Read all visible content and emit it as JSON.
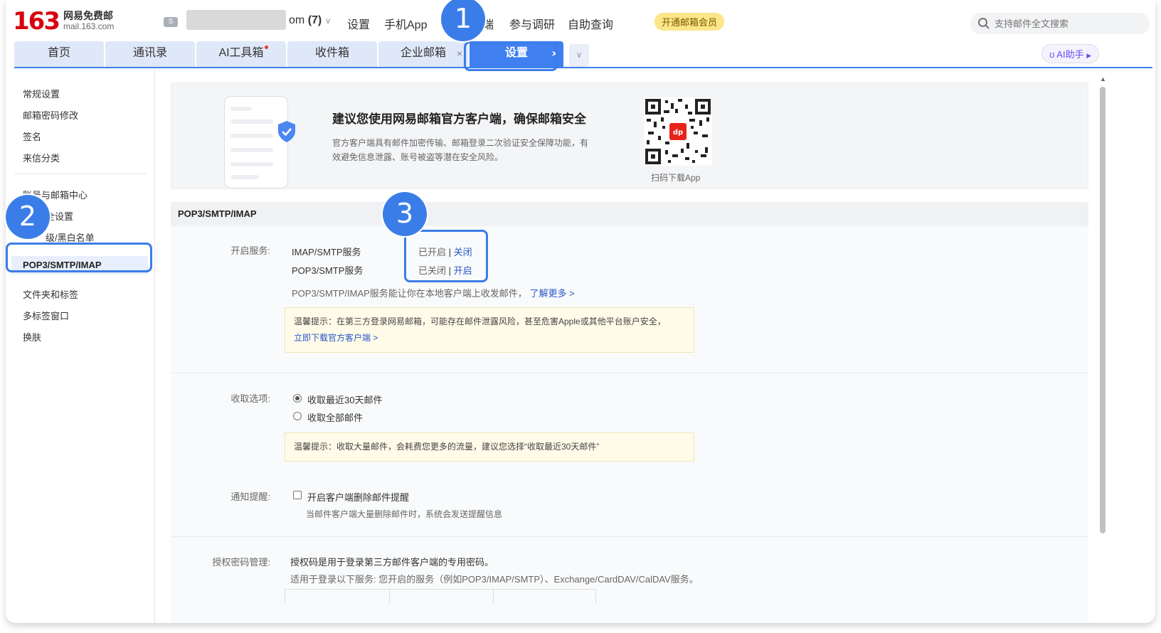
{
  "header": {
    "logo_number": "163",
    "logo_cn": "网易免费邮",
    "logo_url": "mail.163.com",
    "account_suffix": "om",
    "account_count": "(7)",
    "links": [
      "设置",
      "手机App",
      "端",
      "参与调研",
      "自助查询"
    ],
    "vip_label": "开通邮箱会员",
    "search_placeholder": "支持邮件全文搜索"
  },
  "tabs": {
    "items": [
      "首页",
      "通讯录",
      "AI工具箱",
      "收件箱",
      "企业邮箱",
      "设置"
    ],
    "close_symbol": "×",
    "more_symbol": "∨",
    "ai_button": "AI助手"
  },
  "sidebar": {
    "group1": [
      "常规设置",
      "邮箱密码修改",
      "签名",
      "来信分类"
    ],
    "group2": [
      "账号与邮箱中心",
      "全设置",
      "级/黑白名单"
    ],
    "active": "POP3/SMTP/IMAP",
    "group3": [
      "文件夹和标签",
      "多标签窗口",
      "换肤"
    ]
  },
  "banner": {
    "title": "建议您使用网易邮箱官方客户端，确保邮箱安全",
    "desc": "官方客户端具有邮件加密传输、邮箱登录二次验证安全保障功能，有效避免信息泄露、账号被盗等潜在安全风险。",
    "qr_label": "扫码下载App"
  },
  "section": {
    "title": "POP3/SMTP/IMAP",
    "service_label": "开启服务:",
    "services": [
      {
        "name": "IMAP/SMTP服务",
        "status": "已开启",
        "action": "关闭"
      },
      {
        "name": "POP3/SMTP服务",
        "status": "已关闭",
        "action": "开启"
      }
    ],
    "service_sep": "|",
    "service_desc": "POP3/SMTP/IMAP服务能让你在本地客户端上收发邮件，",
    "learn_more": "了解更多 >",
    "tip1": "温馨提示：在第三方登录网易邮箱，可能存在邮件泄露风险，甚至危害Apple或其他平台账户安全，",
    "tip1_link": "立即下载官方客户端 >",
    "fetch_label": "收取选项:",
    "fetch_opt1": "收取最近30天邮件",
    "fetch_opt2": "收取全部邮件",
    "tip2": "温馨提示：收取大量邮件，会耗费您更多的流量，建议您选择“收取最近30天邮件”",
    "notify_label": "通知提醒:",
    "notify_opt": "开启客户端删除邮件提醒",
    "notify_desc": "当邮件客户端大量删除邮件时，系统会发送提醒信息",
    "auth_label": "授权密码管理:",
    "auth_desc1": "授权码是用于登录第三方邮件客户端的专用密码。",
    "auth_desc2": "适用于登录以下服务: 您开启的服务（例如POP3/IMAP/SMTP）、Exchange/CardDAV/CalDAV服务。"
  },
  "annotations": [
    "1",
    "2",
    "3"
  ]
}
